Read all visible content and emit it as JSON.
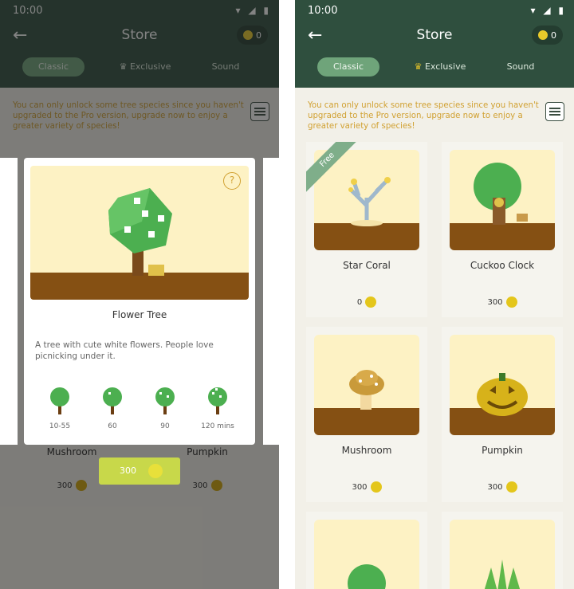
{
  "status": {
    "time": "10:00",
    "icons": "▾ ◢ ▮"
  },
  "header": {
    "title": "Store",
    "coins": "0"
  },
  "tabs": [
    {
      "label": "Classic"
    },
    {
      "label": "Exclusive"
    },
    {
      "label": "Sound"
    }
  ],
  "notice": "You can only unlock some tree species since you haven't upgraded to the Pro version, upgrade now to enjoy a greater variety of species!",
  "free_badge": "Free",
  "trees": [
    {
      "name": "Star Coral",
      "price": "0"
    },
    {
      "name": "Cuckoo Clock",
      "price": "300"
    },
    {
      "name": "Mushroom",
      "price": "300"
    },
    {
      "name": "Pumpkin",
      "price": "300"
    }
  ],
  "modal": {
    "name": "Flower Tree",
    "help": "?",
    "description": "A tree with cute white flowers. People love picnicking under it.",
    "stages": [
      "10-55",
      "60",
      "90",
      "120 mins"
    ],
    "price": "300"
  },
  "colors": {
    "header": "#2f4f3e",
    "accent": "#6fa47a",
    "notice": "#d1a132",
    "ground": "#855013",
    "coin": "#e4c61b"
  }
}
